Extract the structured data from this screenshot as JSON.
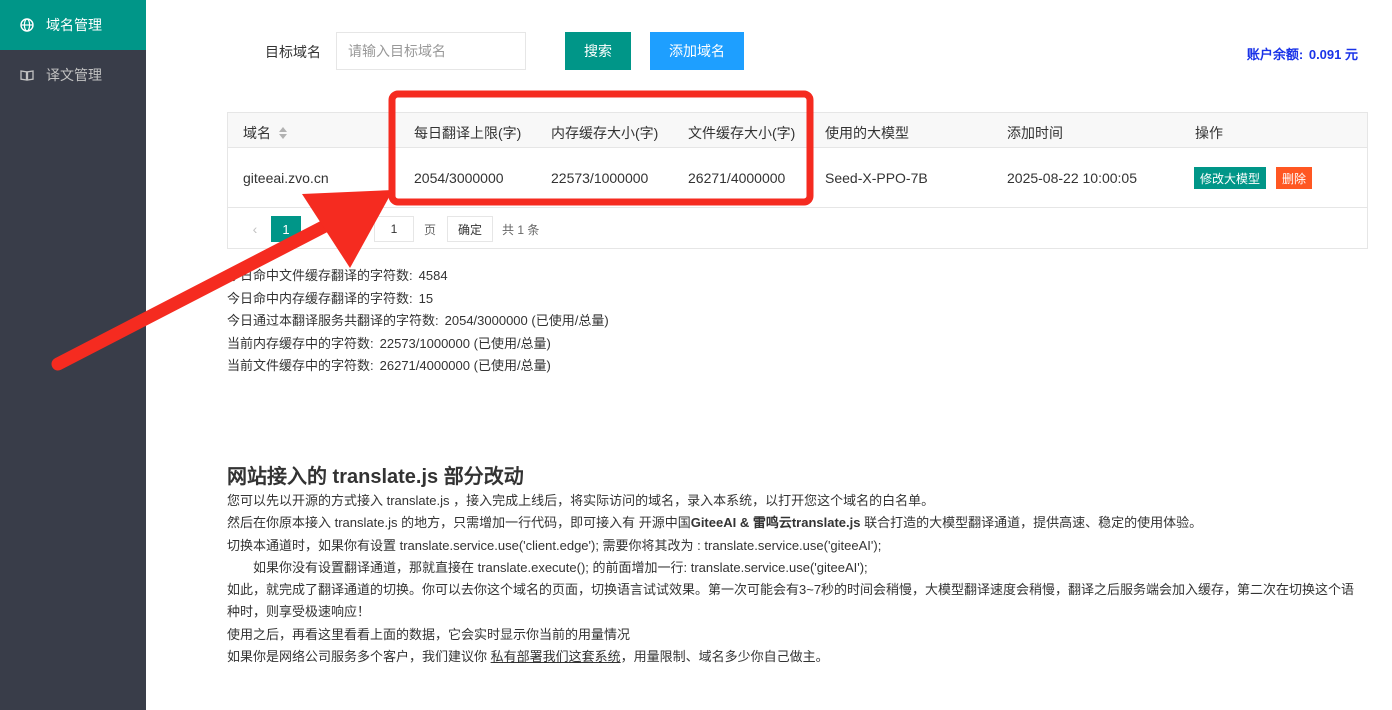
{
  "sidebar": {
    "items": [
      {
        "label": "域名管理",
        "icon": "globe-icon",
        "active": true
      },
      {
        "label": "译文管理",
        "icon": "book-icon",
        "active": false
      }
    ]
  },
  "toolbar": {
    "target_label": "目标域名",
    "search_placeholder": "请输入目标域名",
    "search_value": "",
    "search_button": "搜索",
    "add_button": "添加域名",
    "balance_label": "账户余额:",
    "balance_value": "0.091 元"
  },
  "table": {
    "columns": [
      "域名",
      "每日翻译上限(字)",
      "内存缓存大小(字)",
      "文件缓存大小(字)",
      "使用的大模型",
      "添加时间",
      "操作"
    ],
    "rows": [
      {
        "domain": "giteeai.zvo.cn",
        "daily_limit": "2054/3000000",
        "memory_cache": "22573/1000000",
        "file_cache": "26271/4000000",
        "model": "Seed-X-PPO-7B",
        "added": "2025-08-22 10:00:05",
        "action_model": "修改大模型",
        "action_delete": "删除"
      }
    ]
  },
  "pagination": {
    "prev": "‹",
    "current": "1",
    "goto_value": "1",
    "page_label": "页",
    "confirm": "确定",
    "total": "共 1 条"
  },
  "stats": [
    {
      "label": "今日命中文件缓存翻译的字符数:",
      "value": "4584"
    },
    {
      "label": "今日命中内存缓存翻译的字符数:",
      "value": "15"
    },
    {
      "label": "今日通过本翻译服务共翻译的字符数:",
      "value": "2054/3000000 (已使用/总量)"
    },
    {
      "label": "当前内存缓存中的字符数:",
      "value": "22573/1000000 (已使用/总量)"
    },
    {
      "label": "当前文件缓存中的字符数:",
      "value": "26271/4000000 (已使用/总量)"
    }
  ],
  "article": {
    "title": "网站接入的 translate.js 部分改动",
    "p1": "您可以先以开源的方式接入 translate.js ，接入完成上线后，将实际访问的域名，录入本系统，以打开您这个域名的白名单。",
    "p2_before": "然后在你原本接入 translate.js 的地方，只需增加一行代码，即可接入有 开源中国",
    "p2_bold": "GiteeAI & 雷鸣云translate.js",
    "p2_after": " 联合打造的大模型翻译通道，提供高速、稳定的使用体验。",
    "p3": "切换本通道时，如果你有设置 translate.service.use('client.edge'); 需要你将其改为 : translate.service.use('giteeAI');",
    "p4": "如果你没有设置翻译通道，那就直接在 translate.execute(); 的前面增加一行: translate.service.use('giteeAI');",
    "p5": "如此，就完成了翻译通道的切换。你可以去你这个域名的页面，切换语言试试效果。第一次可能会有3~7秒的时间会稍慢，大模型翻译速度会稍慢，翻译之后服务端会加入缓存，第二次在切换这个语种时，则享受极速响应！",
    "p6": "使用之后，再看这里看看上面的数据，它会实时显示你当前的用量情况",
    "p7_before": "如果你是网络公司服务多个客户，我们建议你 ",
    "p7_link": "私有部署我们这套系统",
    "p7_after": "，用量限制、域名多少你自己做主。"
  },
  "colors": {
    "sidebar_bg": "#393d49",
    "accent_green": "#009688",
    "accent_blue": "#1e9fff",
    "danger": "#ff5722",
    "annotation_red": "#f52b20",
    "balance_text": "#1a33e8"
  }
}
